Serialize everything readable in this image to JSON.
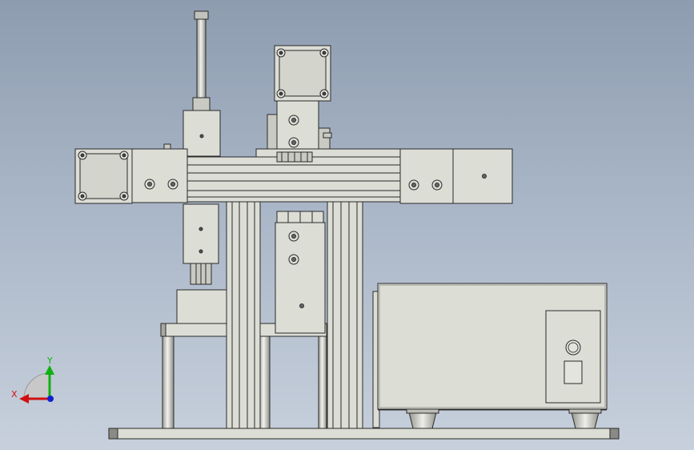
{
  "axes": {
    "x_label": "X",
    "y_label": "Y",
    "x_color": "#d01010",
    "y_color": "#10b010",
    "z_color": "#1020d0"
  },
  "colors": {
    "part_fill": "#dcddd5",
    "part_fill_dark": "#c9cac2",
    "edge": "#2a2a2a",
    "background_top": "#8e9cb0",
    "background_bottom": "#c7d0dc"
  }
}
